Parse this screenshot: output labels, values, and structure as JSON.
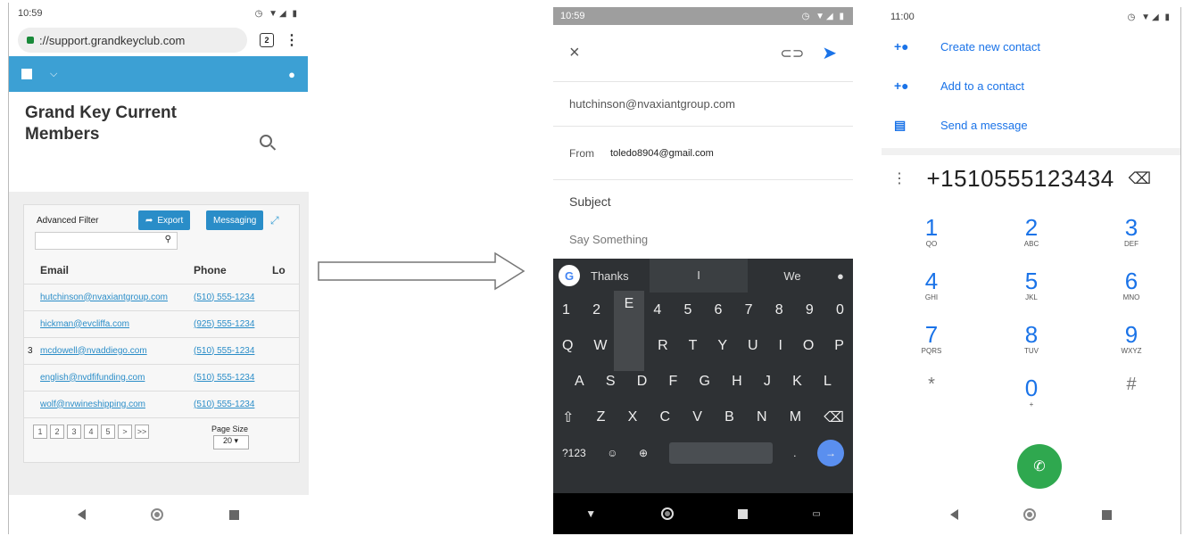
{
  "p1": {
    "status_time": "10:59",
    "status_icons": "◷ ▼◢ ▮",
    "url": "://support.grandkeyclub.com",
    "tab_count": "2",
    "page_title": "Grand Key Current Members",
    "advanced_filter": "Advanced Filter",
    "export": "Export",
    "messaging": "Messaging",
    "col_email": "Email",
    "col_phone": "Phone",
    "col_lo": "Lo",
    "rows": [
      {
        "email": "hutchinson@nvaxiantgroup.com",
        "phone": "(510) 555-1234"
      },
      {
        "email": "hickman@evcliffa.com",
        "phone": "(925) 555-1234"
      },
      {
        "email": "mcdowell@nvaddiego.com",
        "phone": "(510) 555-1234"
      },
      {
        "email": "english@nvdfifunding.com",
        "phone": "(510) 555-1234"
      },
      {
        "email": "wolf@nvwineshipping.com",
        "phone": "(510) 555-1234"
      }
    ],
    "row3_prefix": "3",
    "pages": [
      "1",
      "2",
      "3",
      "4",
      "5",
      ">",
      ">>"
    ],
    "page_size_label": "Page Size",
    "page_size": "20"
  },
  "p2": {
    "status_time": "10:59",
    "to": "hutchinson@nvaxiantgroup.com",
    "from_label": "From",
    "from": "toledo8904@gmail.com",
    "subject": "Subject",
    "body": "Say Something",
    "suggestions": [
      "Thanks",
      "I",
      "We"
    ],
    "popup_key": "E",
    "rows": [
      [
        "1",
        "2",
        "3",
        "4",
        "5",
        "6",
        "7",
        "8",
        "9",
        "0"
      ],
      [
        "Q",
        "W",
        "E",
        "R",
        "T",
        "Y",
        "U",
        "I",
        "O",
        "P"
      ],
      [
        "A",
        "S",
        "D",
        "F",
        "G",
        "H",
        "J",
        "K",
        "L"
      ],
      [
        "Z",
        "X",
        "C",
        "V",
        "B",
        "N",
        "M"
      ]
    ],
    "sym": "?123",
    "period": "."
  },
  "p3": {
    "status_time": "11:00",
    "menu": [
      "Create new contact",
      "Add to a contact",
      "Send a message"
    ],
    "number": "+1510555123434",
    "keys": [
      {
        "d": "1",
        "l": "QO"
      },
      {
        "d": "2",
        "l": "ABC"
      },
      {
        "d": "3",
        "l": "DEF"
      },
      {
        "d": "4",
        "l": "GHI"
      },
      {
        "d": "5",
        "l": "JKL"
      },
      {
        "d": "6",
        "l": "MNO"
      },
      {
        "d": "7",
        "l": "PQRS"
      },
      {
        "d": "8",
        "l": "TUV"
      },
      {
        "d": "9",
        "l": "WXYZ"
      },
      {
        "d": "*",
        "l": ""
      },
      {
        "d": "0",
        "l": "+"
      },
      {
        "d": "#",
        "l": ""
      }
    ]
  },
  "colors": {
    "accent_blue": "#3ca0d4",
    "call_green": "#2fa84f",
    "keyboard_bg": "#2e3134"
  }
}
